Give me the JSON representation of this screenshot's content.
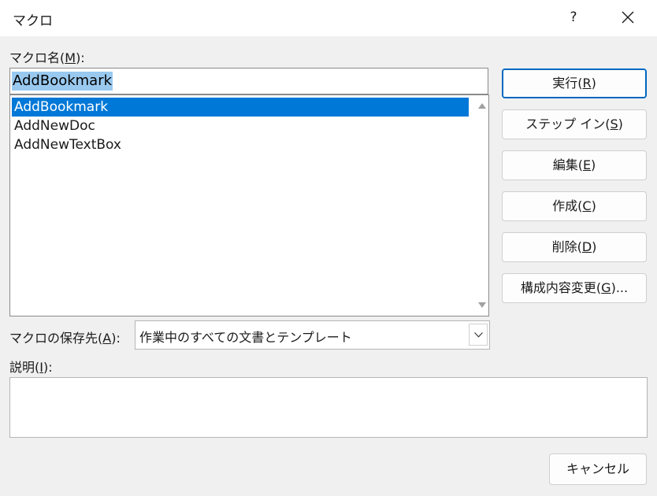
{
  "window": {
    "title": "マクロ",
    "help": "?"
  },
  "macro_name": {
    "label_prefix": "マクロ名(",
    "label_key": "M",
    "label_suffix": "):",
    "value": "AddBookmark"
  },
  "macro_list": {
    "items": [
      "AddBookmark",
      "AddNewDoc",
      "AddNewTextBox"
    ],
    "selected_index": 0
  },
  "buttons": [
    {
      "prefix": "実行(",
      "key": "R",
      "suffix": ")"
    },
    {
      "prefix": "ステップ イン(",
      "key": "S",
      "suffix": ")"
    },
    {
      "prefix": "編集(",
      "key": "E",
      "suffix": ")"
    },
    {
      "prefix": "作成(",
      "key": "C",
      "suffix": ")"
    },
    {
      "prefix": "削除(",
      "key": "D",
      "suffix": ")"
    },
    {
      "prefix": "構成内容変更(",
      "key": "G",
      "suffix": ")..."
    }
  ],
  "macros_in": {
    "label_prefix": "マクロの保存先(",
    "label_key": "A",
    "label_suffix": "):",
    "value": "作業中のすべての文書とテンプレート"
  },
  "description": {
    "label_prefix": "説明(",
    "label_key": "I",
    "label_suffix": "):",
    "value": ""
  },
  "cancel_label": "キャンセル",
  "colors": {
    "selection": "#0078d7",
    "text_highlight": "#99c9ef",
    "default_button_border": "#0067c0"
  }
}
